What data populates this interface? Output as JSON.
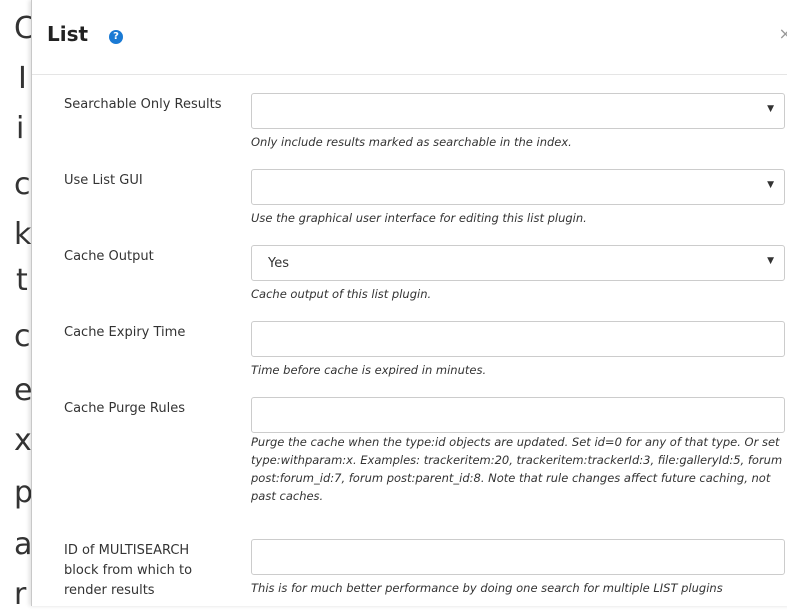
{
  "background_letters": [
    "C",
    "I",
    "i",
    "c",
    "k",
    "t",
    "c",
    "e",
    "x",
    "p",
    "a",
    "r"
  ],
  "modal": {
    "title": "List",
    "help_icon": "?",
    "close_icon": "×"
  },
  "fields": [
    {
      "label": "Searchable Only Results",
      "type": "select",
      "value": "",
      "help": "Only include results marked as searchable in the index."
    },
    {
      "label": "Use List GUI",
      "type": "select",
      "value": "",
      "help": "Use the graphical user interface for editing this list plugin."
    },
    {
      "label": "Cache Output",
      "type": "select",
      "value": "Yes",
      "help": "Cache output of this list plugin."
    },
    {
      "label": "Cache Expiry Time",
      "type": "text",
      "value": "",
      "help": "Time before cache is expired in minutes."
    },
    {
      "label": "Cache Purge Rules",
      "type": "text",
      "value": "",
      "help": "Purge the cache when the type:id objects are updated. Set id=0 for any of that type. Or set type:withparam:x. Examples: trackeritem:20, trackeritem:trackerId:3, file:galleryId:5, forum post:forum_id:7, forum post:parent_id:8. Note that rule changes affect future caching, not past caches."
    },
    {
      "label": "ID of MULTISEARCH block from which to render results",
      "type": "text",
      "value": "",
      "help": "This is for much better performance by doing one search for multiple LIST plugins"
    }
  ]
}
